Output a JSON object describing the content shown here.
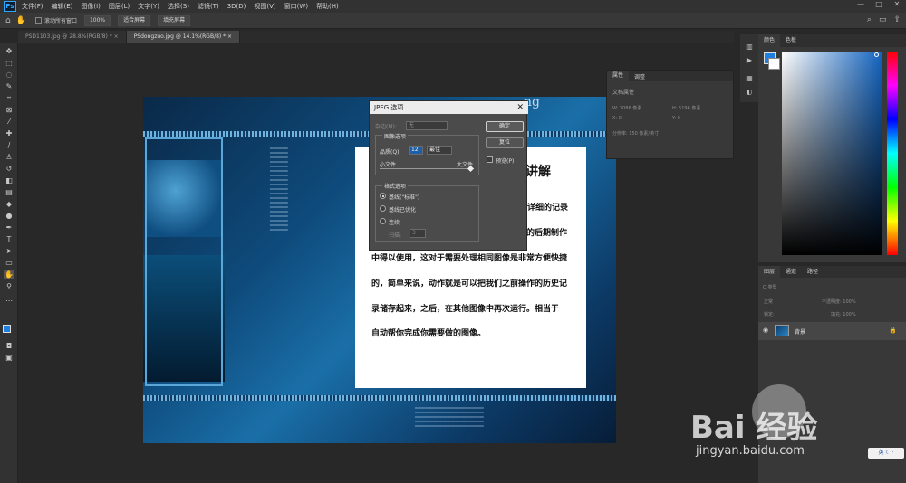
{
  "app": {
    "logo": "Ps"
  },
  "menu": [
    "文件(F)",
    "编辑(E)",
    "图像(I)",
    "图层(L)",
    "文字(Y)",
    "选择(S)",
    "滤镜(T)",
    "3D(D)",
    "视图(V)",
    "窗口(W)",
    "帮助(H)"
  ],
  "window_controls": [
    "—",
    "□",
    "✕"
  ],
  "options": {
    "scroll_all": "滚动所有窗口",
    "zoom_100": "100%",
    "fit_screen": "适合屏幕",
    "fill_screen": "填充屏幕"
  },
  "tabs": [
    {
      "label": "PSD1103.jpg @ 28.8%(RGB/8) *  ×"
    },
    {
      "label": "PSdongzuo.jpg @ 14.1%(RGB/8) *  ×"
    }
  ],
  "document": {
    "heading_fragment": "讲解",
    "title_fragment": "ng",
    "lines": [
      "详细的记录",
      "像的后期制作",
      "中得以使用，这对于需要处理相同图像是非常方便快捷",
      "的，简单来说，动作就是可以把我们之前操作的历史记",
      "录储存起来，之后，在其他图像中再次运行。相当于",
      "自动帮你完成你需要做的图像。"
    ]
  },
  "jpeg_dialog": {
    "title": "JPEG 选项",
    "matte_label": "杂边(M):",
    "matte_value": "无",
    "image_options_label": "图像选项",
    "quality_label": "品质(Q):",
    "quality_value": "12",
    "quality_preset": "最佳",
    "small_file": "小文件",
    "large_file": "大文件",
    "format_label": "格式选项",
    "baseline_standard": "基线(\"标准\")",
    "baseline_optimized": "基线已优化",
    "progressive": "连续",
    "scans_label": "扫描:",
    "scans_value": "3",
    "ok": "确定",
    "reset": "复位",
    "preview": "预览(P)"
  },
  "properties": {
    "tab_properties": "属性",
    "tab_adjust": "调整",
    "doc_props": "文档属性",
    "w_label": "W: 7086 像素",
    "h_label": "H: 5196 像素",
    "x_label": "X: 0",
    "y_label": "Y: 0",
    "resolution": "分辨率: 150 像素/英寸"
  },
  "color_panel": {
    "tab_color": "颜色",
    "tab_swatches": "色板",
    "fg_color": "#1f7fe0"
  },
  "layers": {
    "tab_layers": "图层",
    "tab_channels": "通道",
    "tab_paths": "路径",
    "kind": "Q 类型",
    "blend": "正常",
    "opacity": "不透明度: 100%",
    "lock": "锁定:",
    "fill": "填充: 100%",
    "layer_name": "背景"
  },
  "watermark": {
    "brand": "Bai  经验",
    "url": "jingyan.baidu.com"
  },
  "ime": {
    "label": "英 ☾ ·"
  }
}
